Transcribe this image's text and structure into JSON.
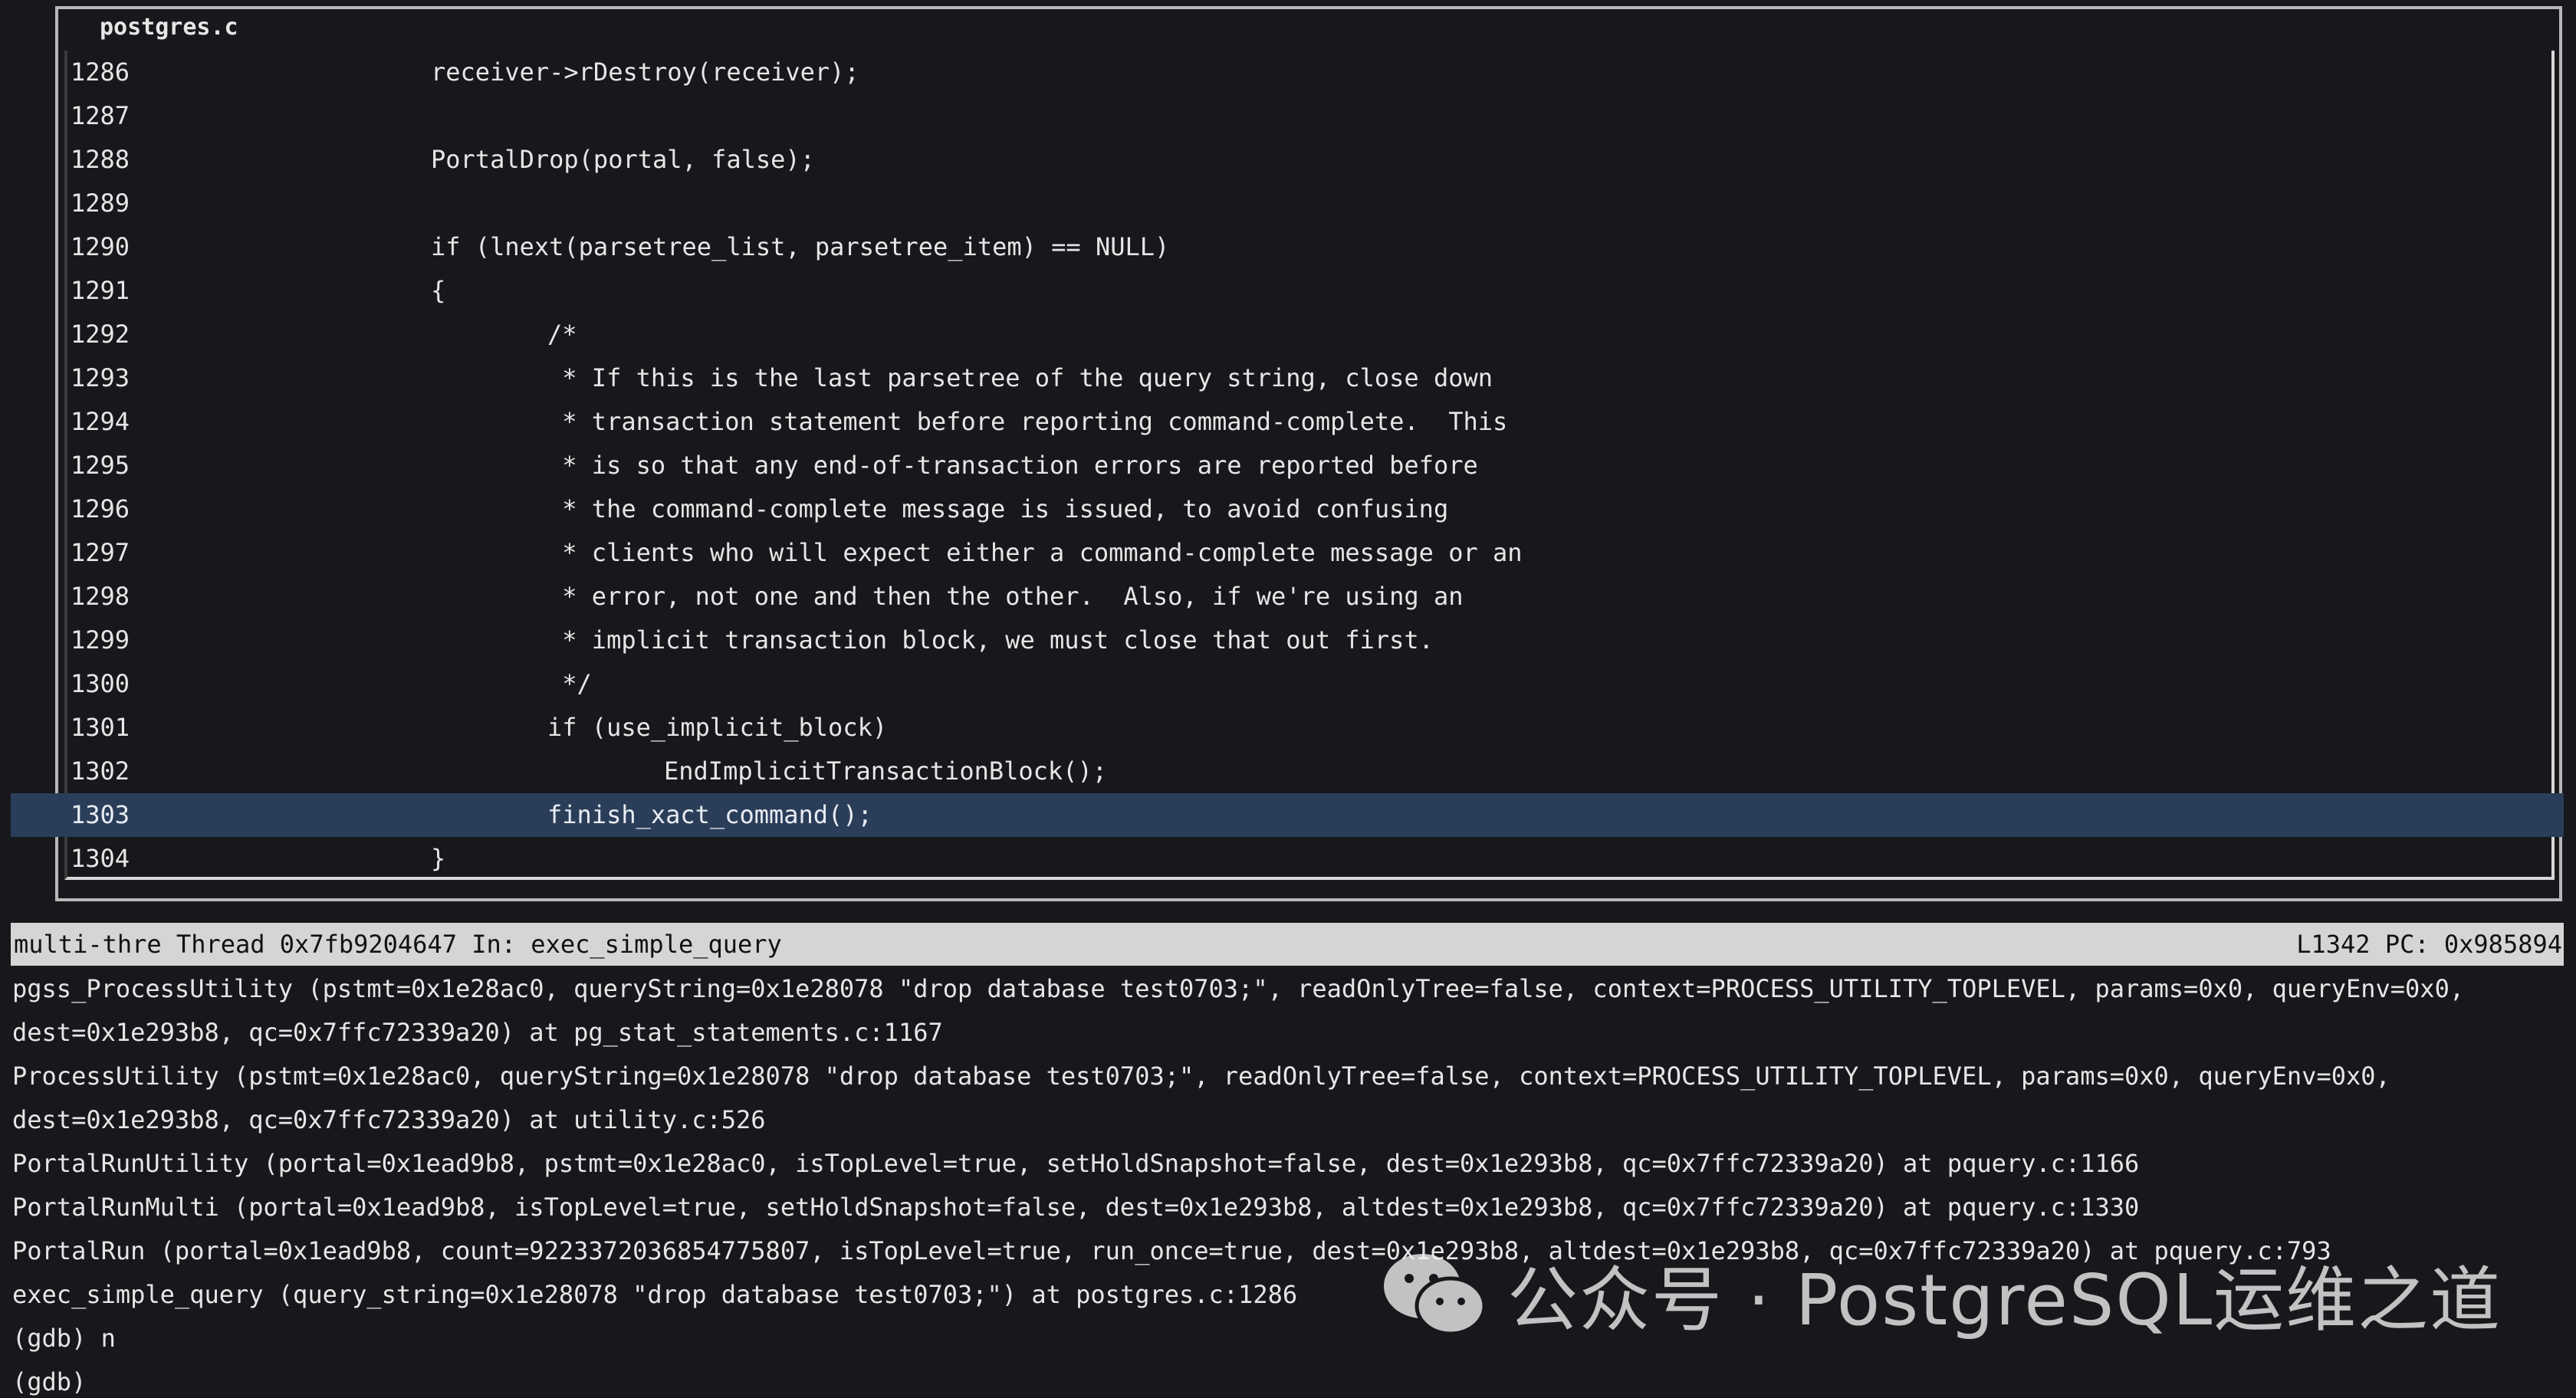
{
  "source_window": {
    "title": "postgres.c",
    "lines": [
      {
        "no": "1286",
        "text": "receiver->rDestroy(receiver);",
        "indent": 0
      },
      {
        "no": "1287",
        "text": "",
        "indent": 0
      },
      {
        "no": "1288",
        "text": "PortalDrop(portal, false);",
        "indent": 0
      },
      {
        "no": "1289",
        "text": "",
        "indent": 0
      },
      {
        "no": "1290",
        "text": "if (lnext(parsetree_list, parsetree_item) == NULL)",
        "indent": 0
      },
      {
        "no": "1291",
        "text": "{",
        "indent": 0
      },
      {
        "no": "1292",
        "text": "/*",
        "indent": 1
      },
      {
        "no": "1293",
        "text": " * If this is the last parsetree of the query string, close down",
        "indent": 1
      },
      {
        "no": "1294",
        "text": " * transaction statement before reporting command-complete.  This",
        "indent": 1
      },
      {
        "no": "1295",
        "text": " * is so that any end-of-transaction errors are reported before",
        "indent": 1
      },
      {
        "no": "1296",
        "text": " * the command-complete message is issued, to avoid confusing",
        "indent": 1
      },
      {
        "no": "1297",
        "text": " * clients who will expect either a command-complete message or an",
        "indent": 1
      },
      {
        "no": "1298",
        "text": " * error, not one and then the other.  Also, if we're using an",
        "indent": 1
      },
      {
        "no": "1299",
        "text": " * implicit transaction block, we must close that out first.",
        "indent": 1
      },
      {
        "no": "1300",
        "text": " */",
        "indent": 1
      },
      {
        "no": "1301",
        "text": "if (use_implicit_block)",
        "indent": 1
      },
      {
        "no": "1302",
        "text": "EndImplicitTransactionBlock();",
        "indent": 2
      },
      {
        "no": "1303",
        "text": "finish_xact_command();",
        "indent": 1,
        "current": true
      },
      {
        "no": "1304",
        "text": "}",
        "indent": 0
      }
    ]
  },
  "status_bar": {
    "left": "multi-thre Thread 0x7fb9204647 In: exec_simple_query",
    "right": "L1342 PC: 0x985894"
  },
  "command_output": [
    "pgss_ProcessUtility (pstmt=0x1e28ac0, queryString=0x1e28078 \"drop database test0703;\", readOnlyTree=false, context=PROCESS_UTILITY_TOPLEVEL, params=0x0, queryEnv=0x0,",
    "dest=0x1e293b8, qc=0x7ffc72339a20) at pg_stat_statements.c:1167",
    "ProcessUtility (pstmt=0x1e28ac0, queryString=0x1e28078 \"drop database test0703;\", readOnlyTree=false, context=PROCESS_UTILITY_TOPLEVEL, params=0x0, queryEnv=0x0,",
    "dest=0x1e293b8, qc=0x7ffc72339a20) at utility.c:526",
    "PortalRunUtility (portal=0x1ead9b8, pstmt=0x1e28ac0, isTopLevel=true, setHoldSnapshot=false, dest=0x1e293b8, qc=0x7ffc72339a20) at pquery.c:1166",
    "PortalRunMulti (portal=0x1ead9b8, isTopLevel=true, setHoldSnapshot=false, dest=0x1e293b8, altdest=0x1e293b8, qc=0x7ffc72339a20) at pquery.c:1330",
    "PortalRun (portal=0x1ead9b8, count=9223372036854775807, isTopLevel=true, run_once=true, dest=0x1e293b8, altdest=0x1e293b8, qc=0x7ffc72339a20) at pquery.c:793",
    "exec_simple_query (query_string=0x1e28078 \"drop database test0703;\") at postgres.c:1286",
    "(gdb) n",
    "(gdb)"
  ],
  "watermark": {
    "text": "公众号 · PostgreSQL运维之道",
    "icon": "wechat-icon"
  },
  "colors": {
    "background": "#17181b",
    "current_line": "#2b3e59",
    "status_bar": "#d5d5d5"
  }
}
